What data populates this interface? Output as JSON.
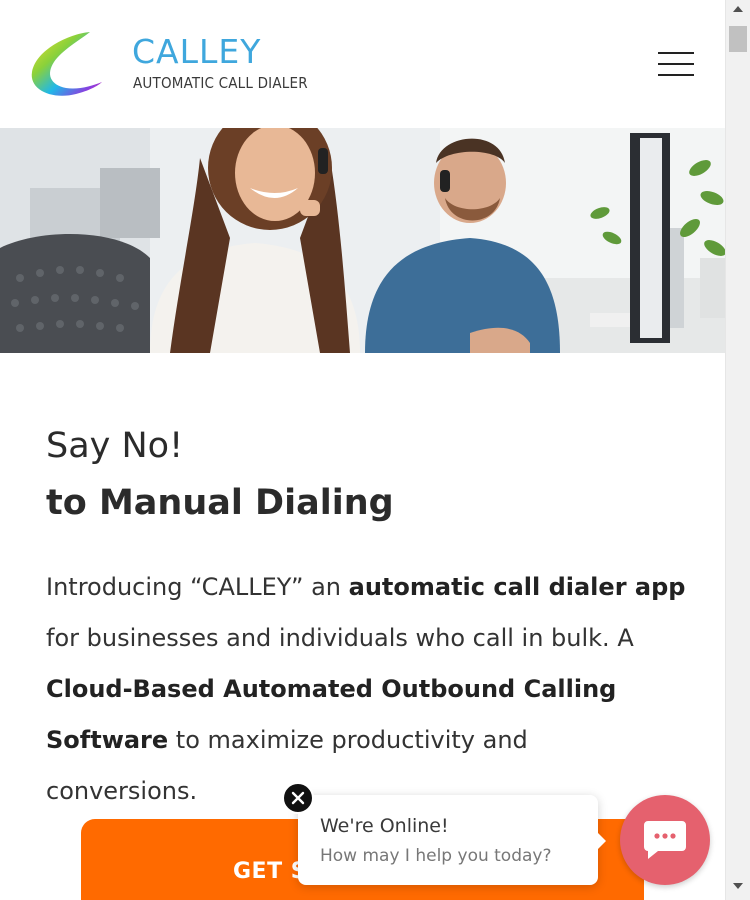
{
  "header": {
    "logo_title": "CALLEY",
    "logo_subtitle": "AUTOMATIC CALL DIALER",
    "menu_icon": "hamburger-menu-icon"
  },
  "hero": {
    "image": "call-center-agents-with-headsets"
  },
  "main": {
    "headline_line1": "Say No!",
    "headline_line2_prefix": "to ",
    "headline_line2_bold": "Manual Dialing",
    "intro_1": "Introducing “CALLEY” an ",
    "intro_bold_1": "automatic call dialer app",
    "intro_2": " for businesses and individuals who call in bulk. A ",
    "intro_bold_2": "Cloud-Based Automated Outbound Calling Software",
    "intro_3": " to maximize productivity and conversions."
  },
  "cta": {
    "label_visible": "GET S"
  },
  "chat": {
    "title": "We're Online!",
    "subtitle": "How may I help you today?",
    "close_icon": "close-icon",
    "launcher_icon": "chat-bubble-icon",
    "launcher_color": "#e5616e"
  },
  "colors": {
    "brand_blue": "#3fa7dd",
    "cta_orange": "#ff6a00"
  }
}
